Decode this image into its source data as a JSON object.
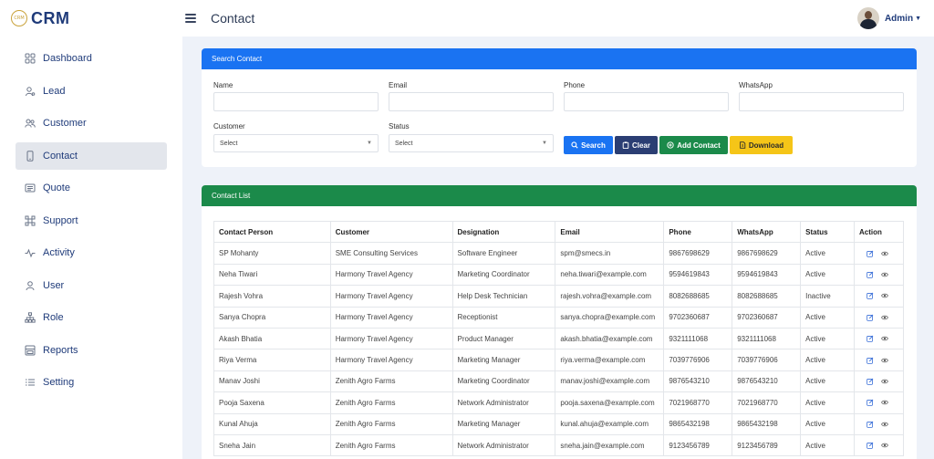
{
  "brand": {
    "logo_text": "CRM",
    "name": "CRM"
  },
  "sidebar": {
    "items": [
      {
        "label": "Dashboard",
        "icon": "dashboard-grid-icon",
        "active": false
      },
      {
        "label": "Lead",
        "icon": "lead-icon",
        "active": false
      },
      {
        "label": "Customer",
        "icon": "customers-icon",
        "active": false
      },
      {
        "label": "Contact",
        "icon": "contact-phone-icon",
        "active": true
      },
      {
        "label": "Quote",
        "icon": "quote-icon",
        "active": false
      },
      {
        "label": "Support",
        "icon": "support-icon",
        "active": false
      },
      {
        "label": "Activity",
        "icon": "activity-icon",
        "active": false
      },
      {
        "label": "User",
        "icon": "user-icon",
        "active": false
      },
      {
        "label": "Role",
        "icon": "role-hierarchy-icon",
        "active": false
      },
      {
        "label": "Reports",
        "icon": "reports-icon",
        "active": false
      },
      {
        "label": "Setting",
        "icon": "settings-list-icon",
        "active": false
      }
    ]
  },
  "topbar": {
    "title": "Contact",
    "user_name": "Admin"
  },
  "search": {
    "header": "Search Contact",
    "name_label": "Name",
    "email_label": "Email",
    "phone_label": "Phone",
    "whatsapp_label": "WhatsApp",
    "customer_label": "Customer",
    "customer_value": "Select",
    "status_label": "Status",
    "status_value": "Select",
    "btn_search": "Search",
    "btn_clear": "Clear",
    "btn_add": "Add Contact",
    "btn_download": "Download"
  },
  "list": {
    "header": "Contact List",
    "columns": [
      "Contact Person",
      "Customer",
      "Designation",
      "Email",
      "Phone",
      "WhatsApp",
      "Status",
      "Action"
    ],
    "rows": [
      [
        "SP Mohanty",
        "SME Consulting Services",
        "Software Engineer",
        "spm@smecs.in",
        "9867698629",
        "9867698629",
        "Active"
      ],
      [
        "Neha Tiwari",
        "Harmony Travel Agency",
        "Marketing Coordinator",
        "neha.tiwari@example.com",
        "9594619843",
        "9594619843",
        "Active"
      ],
      [
        "Rajesh Vohra",
        "Harmony Travel Agency",
        "Help Desk Technician",
        "rajesh.vohra@example.com",
        "8082688685",
        "8082688685",
        "Inactive"
      ],
      [
        "Sanya Chopra",
        "Harmony Travel Agency",
        "Receptionist",
        "sanya.chopra@example.com",
        "9702360687",
        "9702360687",
        "Active"
      ],
      [
        "Akash Bhatia",
        "Harmony Travel Agency",
        "Product Manager",
        "akash.bhatia@example.com",
        "9321111068",
        "9321111068",
        "Active"
      ],
      [
        "Riya Verma",
        "Harmony Travel Agency",
        "Marketing Manager",
        "riya.verma@example.com",
        "7039776906",
        "7039776906",
        "Active"
      ],
      [
        "Manav Joshi",
        "Zenith Agro Farms",
        "Marketing Coordinator",
        "manav.joshi@example.com",
        "9876543210",
        "9876543210",
        "Active"
      ],
      [
        "Pooja Saxena",
        "Zenith Agro Farms",
        "Network Administrator",
        "pooja.saxena@example.com",
        "7021968770",
        "7021968770",
        "Active"
      ],
      [
        "Kunal Ahuja",
        "Zenith Agro Farms",
        "Marketing Manager",
        "kunal.ahuja@example.com",
        "9865432198",
        "9865432198",
        "Active"
      ],
      [
        "Sneha Jain",
        "Zenith Agro Farms",
        "Network Administrator",
        "sneha.jain@example.com",
        "9123456789",
        "9123456789",
        "Active"
      ]
    ]
  },
  "colors": {
    "primary": "#1a73f2",
    "success": "#1b8a4a",
    "navy": "#2b3e73",
    "warning": "#f5c518",
    "brand_text": "#1f3b7a"
  }
}
